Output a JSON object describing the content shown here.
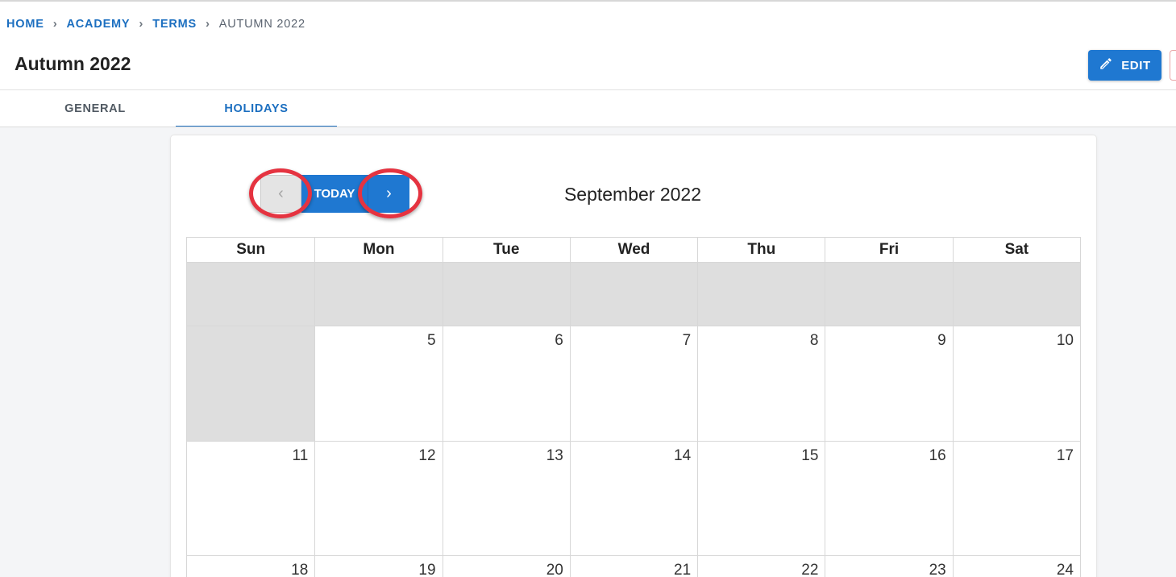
{
  "breadcrumb": {
    "items": [
      "HOME",
      "ACADEMY",
      "TERMS"
    ],
    "current": "AUTUMN 2022",
    "separator": "›"
  },
  "page": {
    "title": "Autumn 2022"
  },
  "actions": {
    "edit_label": "EDIT",
    "edit_icon": "pencil-icon"
  },
  "tabs": [
    {
      "label": "GENERAL",
      "active": false
    },
    {
      "label": "HOLIDAYS",
      "active": true
    }
  ],
  "calendar": {
    "month_title": "September 2022",
    "today_label": "TODAY",
    "prev_icon": "chevron-left-icon",
    "next_icon": "chevron-right-icon",
    "day_names": [
      "Sun",
      "Mon",
      "Tue",
      "Wed",
      "Thu",
      "Fri",
      "Sat"
    ],
    "weeks": [
      [
        "",
        "",
        "",
        "",
        "",
        "",
        ""
      ],
      [
        "",
        "5",
        "6",
        "7",
        "8",
        "9",
        "10"
      ],
      [
        "11",
        "12",
        "13",
        "14",
        "15",
        "16",
        "17"
      ],
      [
        "18",
        "19",
        "20",
        "21",
        "22",
        "23",
        "24"
      ]
    ]
  },
  "colors": {
    "primary": "#1f78d1",
    "link": "#1c6fc0",
    "disabled_cell": "#dedede",
    "highlight_ring": "#e53340"
  }
}
